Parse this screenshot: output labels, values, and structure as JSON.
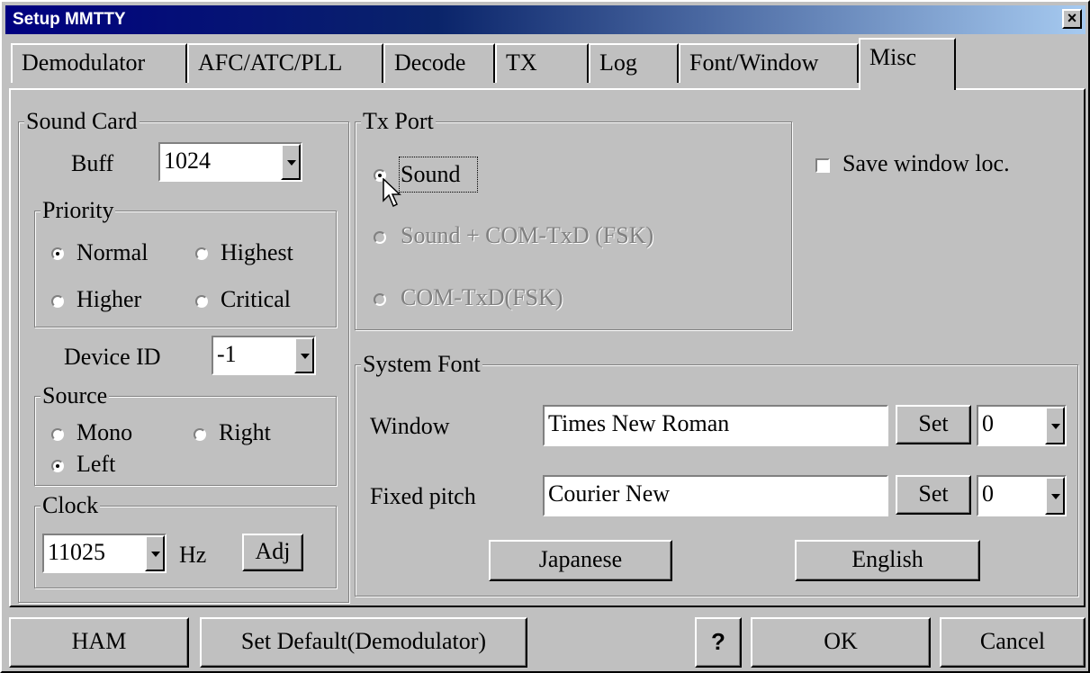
{
  "window": {
    "title": "Setup MMTTY",
    "close_label": "×"
  },
  "tabs": [
    "Demodulator",
    "AFC/ATC/PLL",
    "Decode",
    "TX",
    "Log",
    "Font/Window",
    "Misc"
  ],
  "active_tab": "Misc",
  "sound_card": {
    "legend": "Sound Card",
    "buff_label": "Buff",
    "buff_value": "1024",
    "priority": {
      "legend": "Priority",
      "options": [
        "Normal",
        "Highest",
        "Higher",
        "Critical"
      ],
      "selected": "Normal"
    },
    "device_id_label": "Device ID",
    "device_id_value": "-1",
    "source": {
      "legend": "Source",
      "options": [
        "Mono",
        "Right",
        "Left"
      ],
      "selected": "Left"
    },
    "clock": {
      "legend": "Clock",
      "value": "11025",
      "unit": "Hz",
      "adj_label": "Adj"
    }
  },
  "tx_port": {
    "legend": "Tx Port",
    "options": [
      "Sound",
      "Sound + COM-TxD (FSK)",
      "COM-TxD(FSK)"
    ],
    "selected": "Sound",
    "disabled": [
      "Sound + COM-TxD (FSK)",
      "COM-TxD(FSK)"
    ]
  },
  "save_window_loc": {
    "label": "Save window loc.",
    "checked": false
  },
  "system_font": {
    "legend": "System Font",
    "window_label": "Window",
    "window_font": "Times New Roman",
    "window_set": "Set",
    "window_charset": "0",
    "fixed_label": "Fixed pitch",
    "fixed_font": "Courier New",
    "fixed_set": "Set",
    "fixed_charset": "0",
    "japanese_label": "Japanese",
    "english_label": "English"
  },
  "footer": {
    "ham_label": "HAM",
    "set_default_label": "Set Default(Demodulator)",
    "help_label": "?",
    "ok_label": "OK",
    "cancel_label": "Cancel"
  }
}
